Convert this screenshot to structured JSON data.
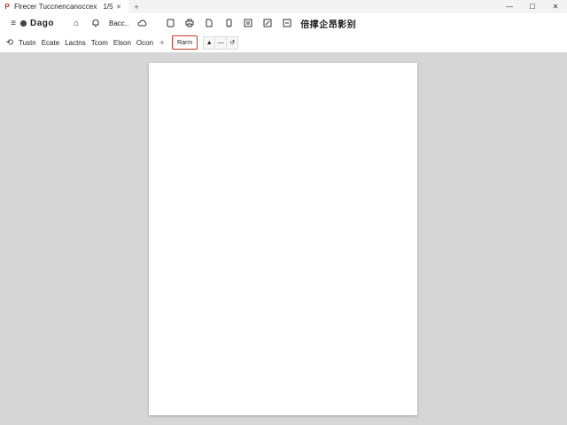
{
  "window": {
    "app_logo": "P",
    "tab_title": "Flrecer  Tuccnencanoccex",
    "tab_counter": "1/5",
    "tab_close_icon": "close-icon",
    "newtab_glyph": "+",
    "controls": {
      "minimize": "—",
      "maximize": "☐",
      "close": "✕"
    }
  },
  "toolbar1": {
    "menu_glyph": "≡",
    "tool_name": "Dago",
    "file_text": "Bacc..",
    "doc_title": "倍撑企昂影别"
  },
  "toolbar2": {
    "tools": [
      "Tustn",
      "Ecate",
      "Lactns",
      "Tcom",
      "Elson",
      "Ocon"
    ],
    "zoom_value": "Rarm",
    "page_controls": {
      "up": "▲",
      "minus": "—",
      "rotate": "↺"
    }
  }
}
